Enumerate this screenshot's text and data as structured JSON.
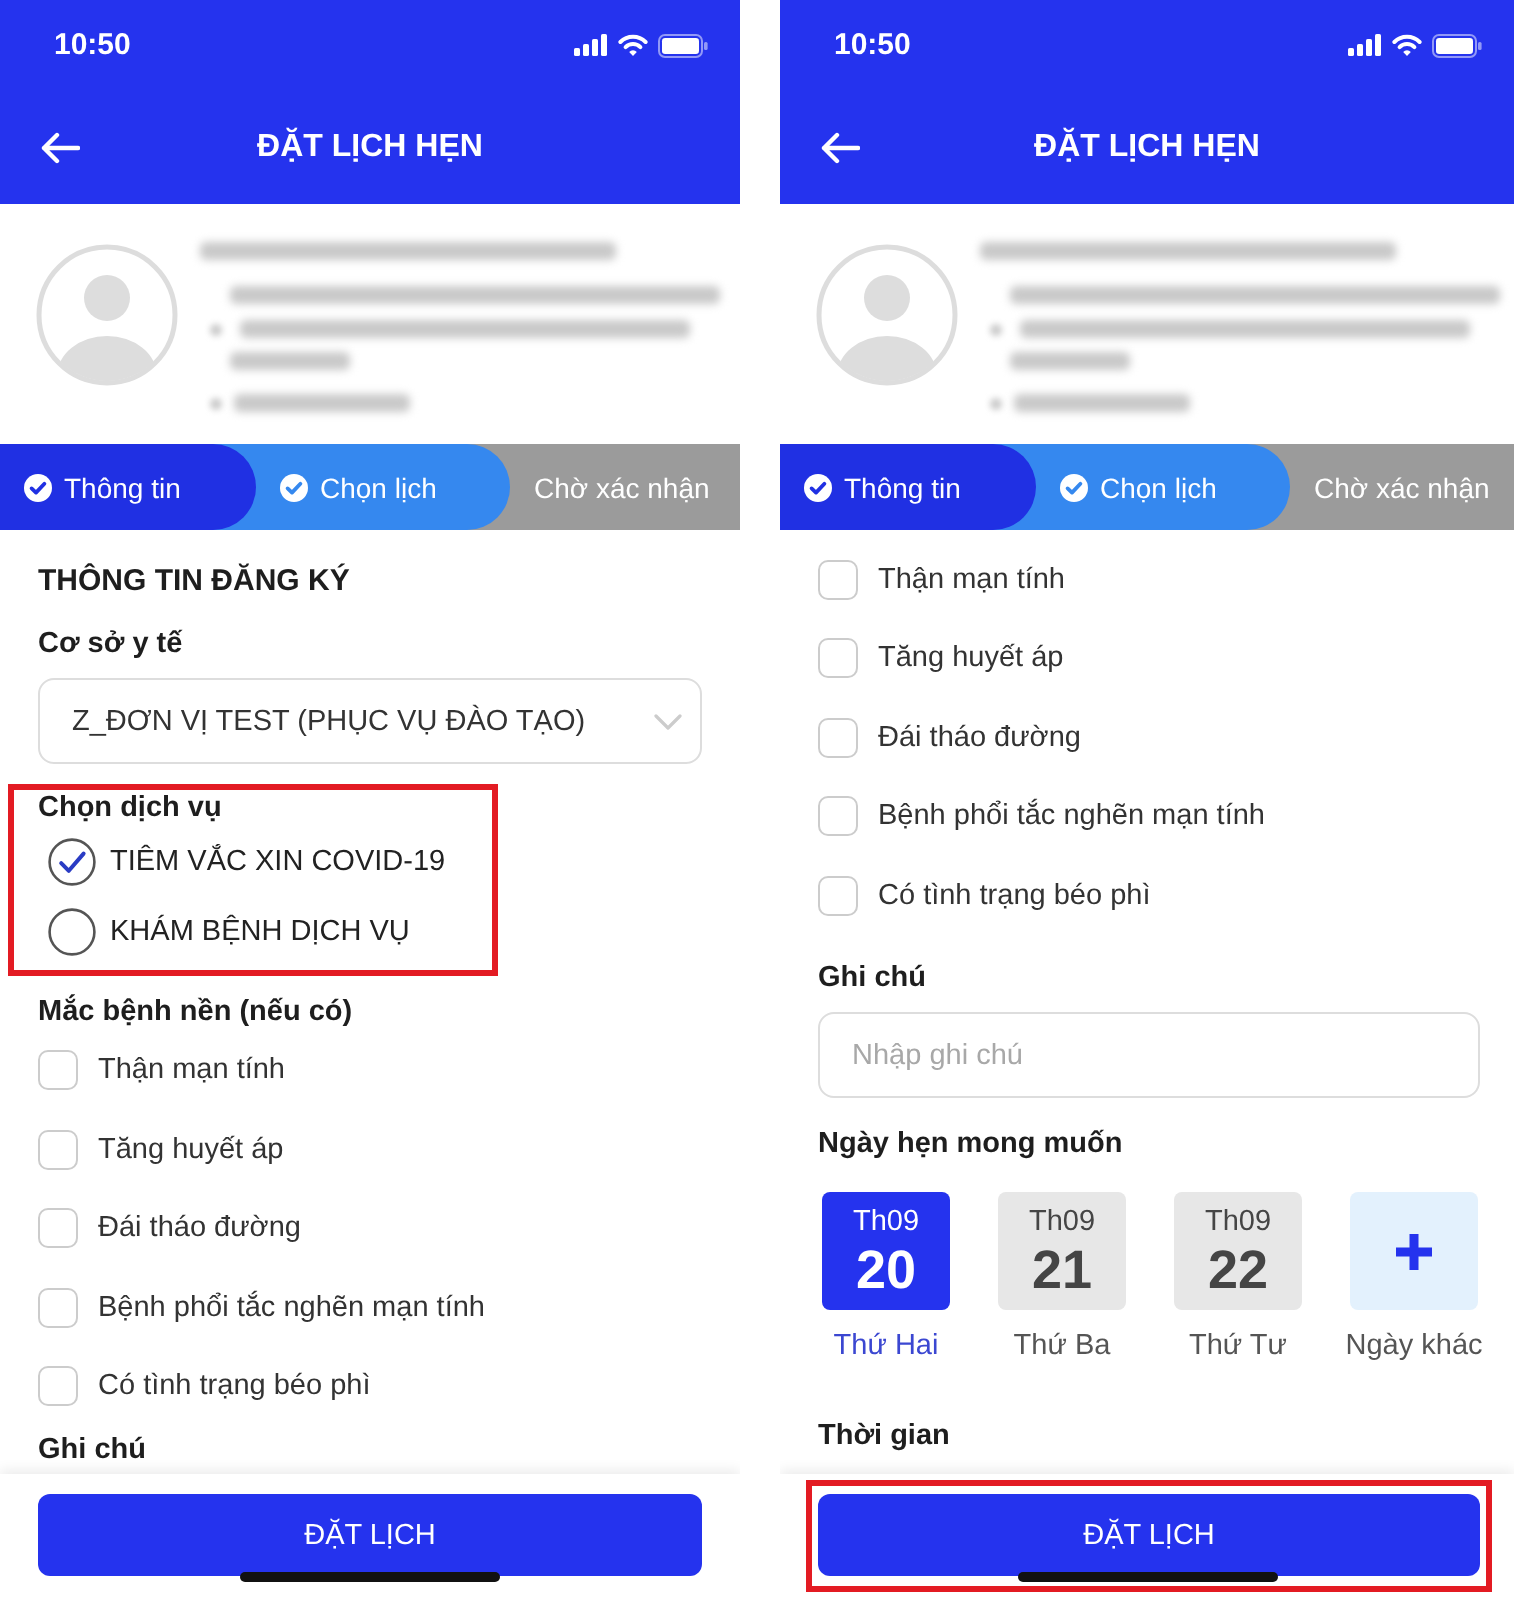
{
  "screens": [
    {
      "status_bar": {
        "time": "10:50"
      },
      "header": {
        "title": "ĐẶT LỊCH HẸN"
      },
      "steps": [
        {
          "label": "Thông tin",
          "done": true,
          "selected": false
        },
        {
          "label": "Chọn lịch",
          "done": true,
          "selected": true
        },
        {
          "label": "Chờ xác nhận",
          "done": false,
          "selected": false
        }
      ],
      "sections": [
        {
          "kind": "heading",
          "text": "THÔNG TIN ĐĂNG KÝ"
        },
        {
          "kind": "select",
          "label": "Cơ sở y tế",
          "value": "Z_ĐƠN VỊ TEST (PHỤC VỤ ĐÀO TẠO)"
        },
        {
          "kind": "radio_group",
          "label": "Chọn dịch vụ",
          "highlighted": true,
          "options": [
            {
              "label": "TIÊM VẮC XIN COVID-19",
              "selected": true
            },
            {
              "label": "KHÁM BỆNH DỊCH VỤ",
              "selected": false
            }
          ]
        },
        {
          "kind": "checkbox_group",
          "label": "Mắc bệnh nền (nếu có)",
          "options": [
            {
              "label": "Thận mạn tính",
              "checked": false
            },
            {
              "label": "Tăng huyết áp",
              "checked": false
            },
            {
              "label": "Đái tháo đường",
              "checked": false
            },
            {
              "label": "Bệnh phổi tắc nghẽn mạn tính",
              "checked": false
            },
            {
              "label": "Có tình trạng béo phì",
              "checked": false
            }
          ]
        },
        {
          "kind": "label",
          "text": "Ghi chú"
        }
      ],
      "submit": {
        "label": "ĐẶT LỊCH",
        "highlighted": false
      }
    },
    {
      "status_bar": {
        "time": "10:50"
      },
      "header": {
        "title": "ĐẶT LỊCH HẸN"
      },
      "steps": [
        {
          "label": "Thông tin",
          "done": true,
          "selected": false
        },
        {
          "label": "Chọn lịch",
          "done": true,
          "selected": true
        },
        {
          "label": "Chờ xác nhận",
          "done": false,
          "selected": false
        }
      ],
      "sections": [
        {
          "kind": "checkbox_group",
          "options": [
            {
              "label": "Thận mạn tính",
              "checked": false
            },
            {
              "label": "Tăng huyết áp",
              "checked": false
            },
            {
              "label": "Đái tháo đường",
              "checked": false
            },
            {
              "label": "Bệnh phổi tắc nghẽn mạn tính",
              "checked": false
            },
            {
              "label": "Có tình trạng béo phì",
              "checked": false
            }
          ]
        },
        {
          "kind": "text_input",
          "label": "Ghi chú",
          "placeholder": "Nhập ghi chú"
        },
        {
          "kind": "date_picker",
          "label": "Ngày hẹn mong muốn",
          "days": [
            {
              "month": "Th09",
              "day": "20",
              "weekday": "Thứ Hai",
              "selected": true
            },
            {
              "month": "Th09",
              "day": "21",
              "weekday": "Thứ Ba",
              "selected": false
            },
            {
              "month": "Th09",
              "day": "22",
              "weekday": "Thứ Tư",
              "selected": false
            }
          ],
          "other": {
            "label": "Ngày khác"
          }
        },
        {
          "kind": "label",
          "text": "Thời gian"
        }
      ],
      "submit": {
        "label": "ĐẶT LỊCH",
        "highlighted": true
      }
    }
  ]
}
